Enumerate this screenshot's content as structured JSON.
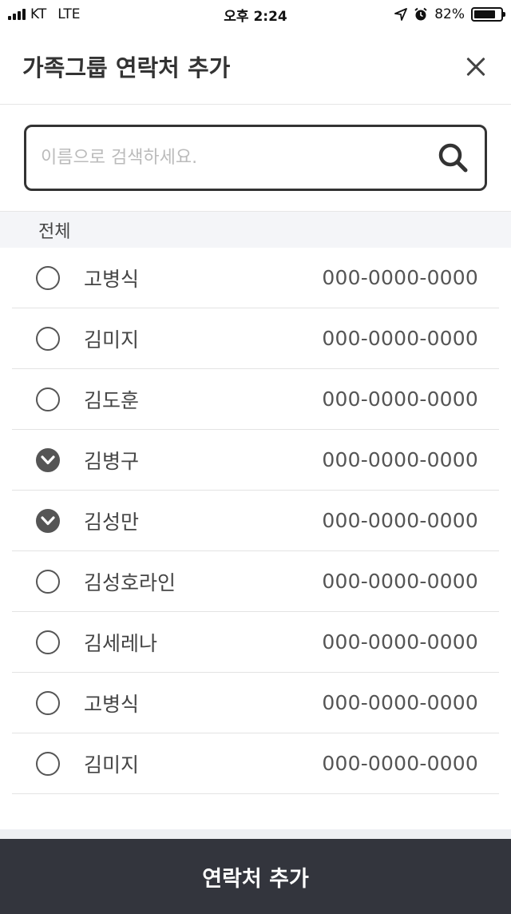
{
  "status_bar": {
    "carrier": "KT",
    "network": "LTE",
    "time": "오후 2:24",
    "battery": "82%",
    "battery_level": 0.82
  },
  "header": {
    "title": "가족그룹 연락처 추가",
    "close_icon": "close-icon"
  },
  "search": {
    "placeholder": "이름으로 검색하세요.",
    "value": "",
    "icon": "search-icon"
  },
  "section": {
    "label": "전체"
  },
  "contacts": [
    {
      "name": "고병식",
      "phone": "000-0000-0000",
      "checked": false
    },
    {
      "name": "김미지",
      "phone": "000-0000-0000",
      "checked": false
    },
    {
      "name": "김도훈",
      "phone": "000-0000-0000",
      "checked": false
    },
    {
      "name": "김병구",
      "phone": "000-0000-0000",
      "checked": true
    },
    {
      "name": "김성만",
      "phone": "000-0000-0000",
      "checked": true
    },
    {
      "name": "김성호라인",
      "phone": "000-0000-0000",
      "checked": false
    },
    {
      "name": "김세레나",
      "phone": "000-0000-0000",
      "checked": false
    },
    {
      "name": "고병식",
      "phone": "000-0000-0000",
      "checked": false
    },
    {
      "name": "김미지",
      "phone": "000-0000-0000",
      "checked": false
    }
  ],
  "footer": {
    "add_label": "연락처 추가"
  }
}
